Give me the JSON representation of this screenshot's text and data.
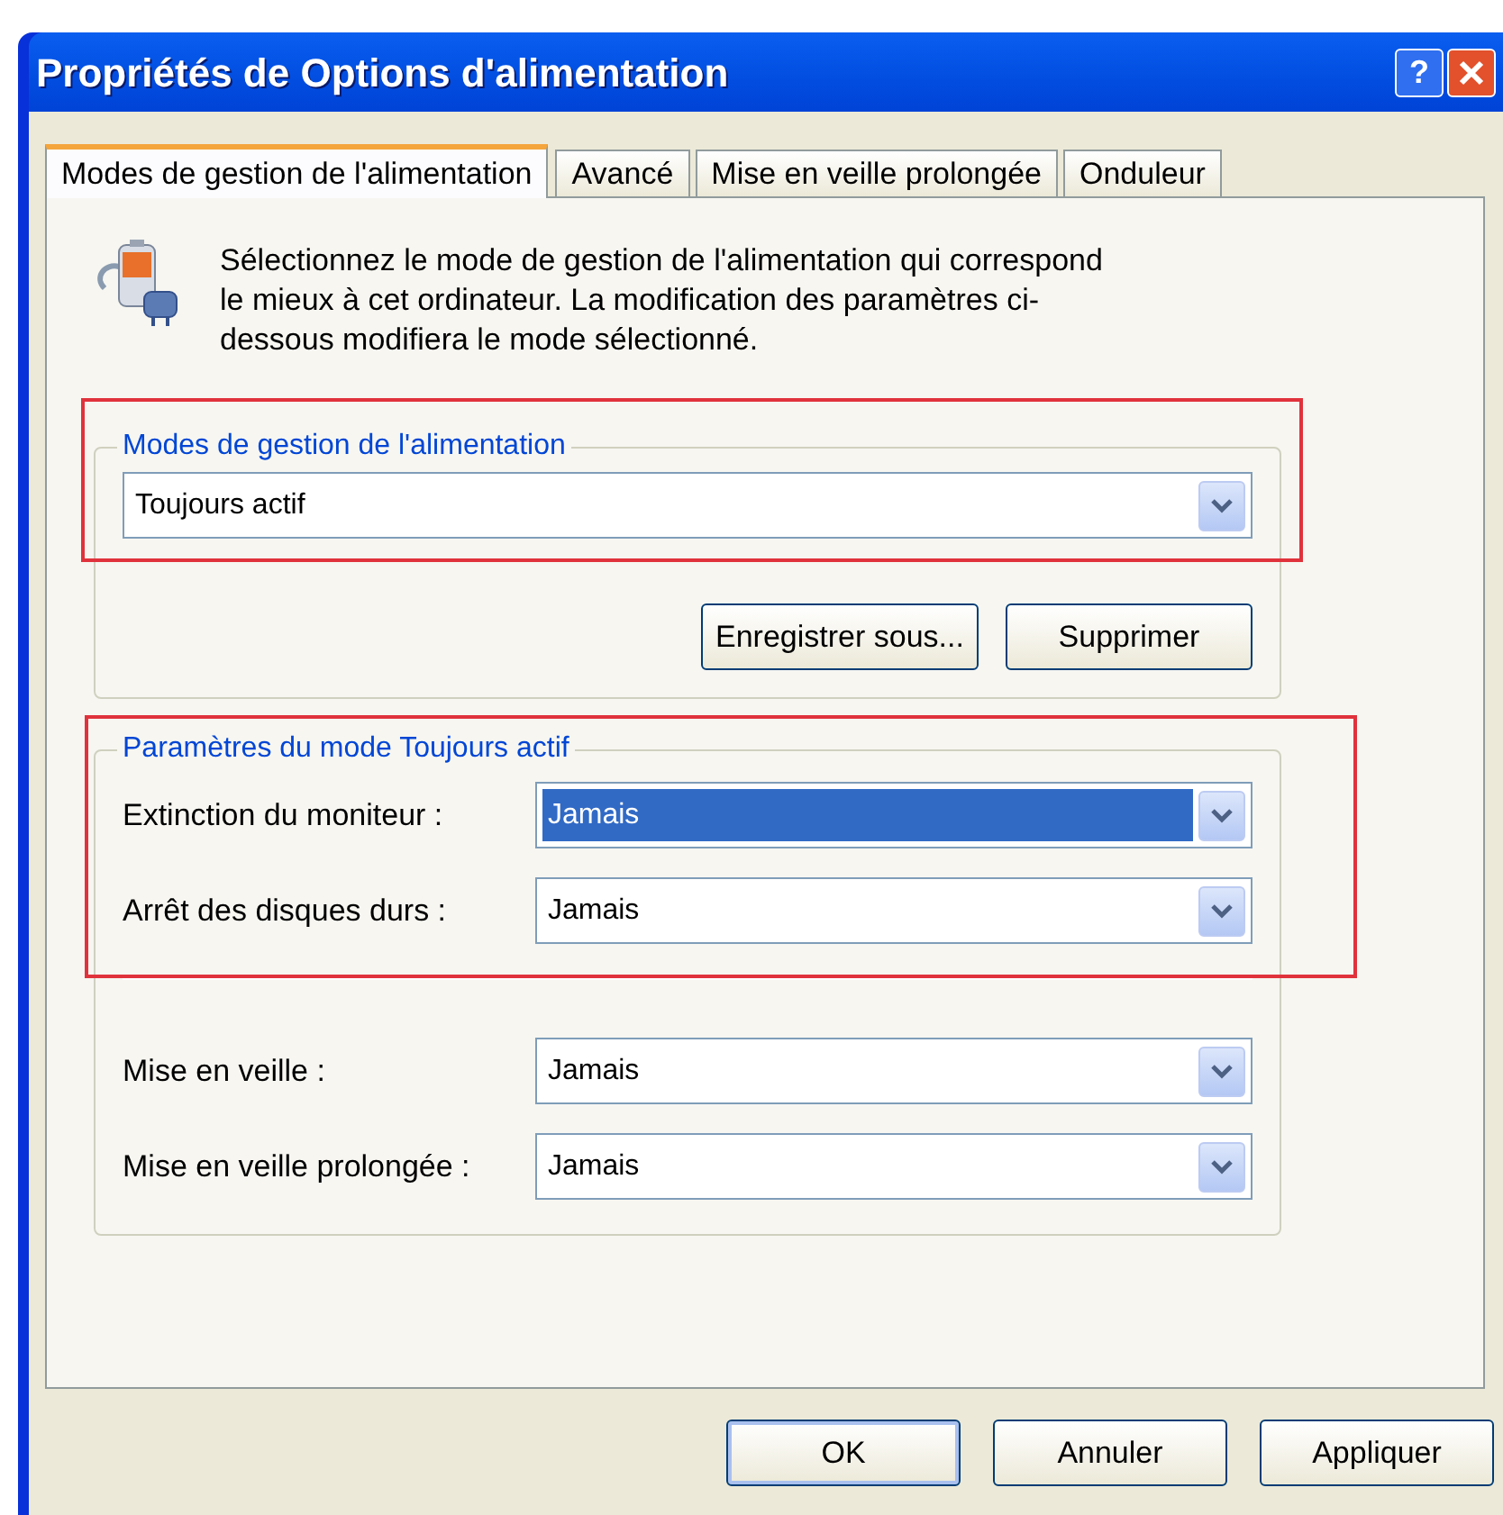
{
  "window": {
    "title": "Propriétés de Options d'alimentation",
    "title_buttons": [
      {
        "kind": "help",
        "label": "?"
      },
      {
        "kind": "close"
      }
    ]
  },
  "tabs": [
    {
      "label": "Modes de gestion de l'alimentation",
      "selected": true
    },
    {
      "label": "Avancé",
      "selected": false
    },
    {
      "label": "Mise en veille prolongée",
      "selected": false
    },
    {
      "label": "Onduleur",
      "selected": false
    }
  ],
  "intro": "Sélectionnez le mode de gestion de l'alimentation qui correspond le mieux à cet ordinateur. La modification des paramètres ci-dessous modifiera le mode sélectionné.",
  "scheme_group": {
    "title": "Modes de gestion de l'alimentation",
    "highlighted": true,
    "value": "Toujours actif",
    "buttons": [
      "Enregistrer sous...",
      "Supprimer"
    ]
  },
  "settings_group": {
    "title": "Paramètres du mode Toujours actif",
    "rows": [
      {
        "label": "Extinction du moniteur :",
        "value": "Jamais",
        "selected": true,
        "highlighted": true
      },
      {
        "label": "Arrêt des disques durs :",
        "value": "Jamais",
        "selected": false,
        "highlighted": true
      },
      {
        "label": "Mise en veille :",
        "value": "Jamais",
        "selected": false,
        "highlighted": false
      },
      {
        "label": "Mise en veille prolongée :",
        "value": "Jamais",
        "selected": false,
        "highlighted": false
      }
    ]
  },
  "buttons": [
    {
      "label": "OK",
      "default": true
    },
    {
      "label": "Annuler",
      "default": false
    },
    {
      "label": "Appliquer",
      "default": false
    }
  ]
}
